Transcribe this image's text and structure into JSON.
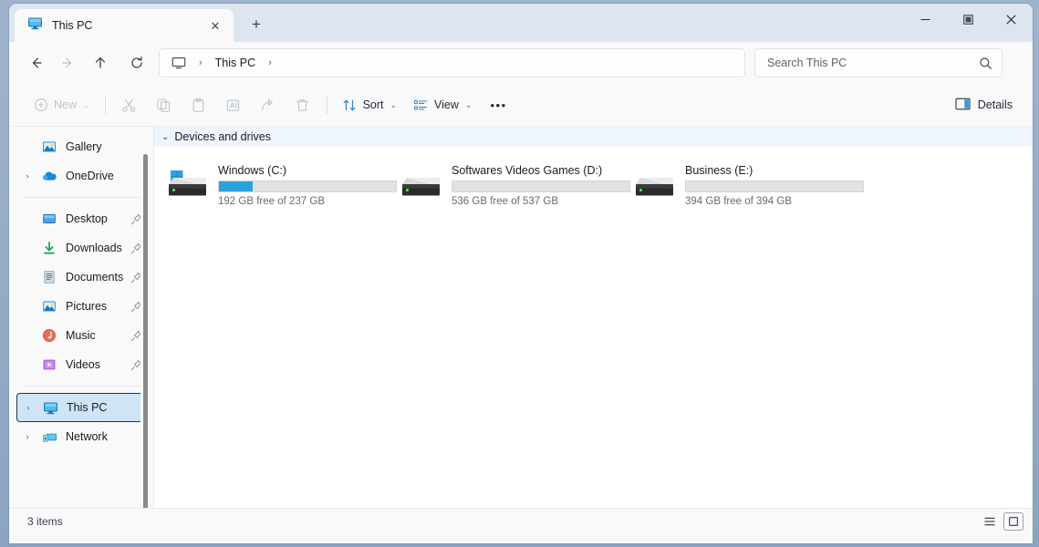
{
  "window": {
    "controls": {
      "minimize": "minimize-button",
      "maximize": "maximize-button",
      "close": "close-button"
    }
  },
  "tabs": [
    {
      "title": "This PC",
      "icon": "this-pc-icon",
      "close_label": "✕"
    }
  ],
  "new_tab_label": "+",
  "navigation": {
    "back": "←",
    "forward": "→",
    "up": "↑",
    "refresh": "↻"
  },
  "breadcrumb": {
    "icon": "this-pc-icon",
    "sep1": "›",
    "item": "This PC",
    "sep2": "›"
  },
  "search": {
    "placeholder": "Search This PC",
    "icon": "search-icon"
  },
  "toolbar": {
    "new_label": "New",
    "cut_label": "Cut",
    "copy_label": "Copy",
    "paste_label": "Paste",
    "rename_label": "Rename",
    "share_label": "Share",
    "delete_label": "Delete",
    "sort_label": "Sort",
    "view_label": "View",
    "more_label": "•••",
    "details_label": "Details",
    "chevron": "⌄"
  },
  "sidebar": {
    "items": [
      {
        "label": "Gallery",
        "icon": "gallery-icon",
        "expandable": false,
        "pinned": false,
        "selected": false
      },
      {
        "label": "OneDrive",
        "icon": "onedrive-icon",
        "expandable": true,
        "pinned": false,
        "selected": false
      },
      {
        "label": "Desktop",
        "icon": "desktop-icon",
        "expandable": false,
        "pinned": true,
        "selected": false
      },
      {
        "label": "Downloads",
        "icon": "downloads-icon",
        "expandable": false,
        "pinned": true,
        "selected": false
      },
      {
        "label": "Documents",
        "icon": "documents-icon",
        "expandable": false,
        "pinned": true,
        "selected": false
      },
      {
        "label": "Pictures",
        "icon": "pictures-icon",
        "expandable": false,
        "pinned": true,
        "selected": false
      },
      {
        "label": "Music",
        "icon": "music-icon",
        "expandable": false,
        "pinned": true,
        "selected": false
      },
      {
        "label": "Videos",
        "icon": "videos-icon",
        "expandable": false,
        "pinned": true,
        "selected": false
      },
      {
        "label": "This PC",
        "icon": "this-pc-icon",
        "expandable": true,
        "pinned": false,
        "selected": true
      },
      {
        "label": "Network",
        "icon": "network-icon",
        "expandable": true,
        "pinned": false,
        "selected": false
      }
    ],
    "expand_chevron": "›",
    "pin_icon": "pin-icon"
  },
  "content": {
    "group_label": "Devices and drives",
    "group_chevron": "⌄",
    "drives": [
      {
        "name": "Windows (C:)",
        "free_text": "192 GB free of 237 GB",
        "free_gb": 192,
        "total_gb": 237,
        "used_percent": 19,
        "bar_color": "#2aa3dd",
        "has_windows_badge": true
      },
      {
        "name": "Softwares Videos Games (D:)",
        "free_text": "536 GB free of 537 GB",
        "free_gb": 536,
        "total_gb": 537,
        "used_percent": 0,
        "bar_color": "#2aa3dd",
        "has_windows_badge": false
      },
      {
        "name": "Business (E:)",
        "free_text": "394 GB free of 394 GB",
        "free_gb": 394,
        "total_gb": 394,
        "used_percent": 0,
        "bar_color": "#2aa3dd",
        "has_windows_badge": false
      }
    ]
  },
  "statusbar": {
    "item_count": "3 items",
    "list_view_icon": "list-view-icon",
    "tile_view_icon": "tile-view-icon"
  },
  "colors": {
    "titlebar": "#dde5ee",
    "accent": "#2aa3dd",
    "selection": "#cfe4f7",
    "group_header": "#eef5fd"
  }
}
